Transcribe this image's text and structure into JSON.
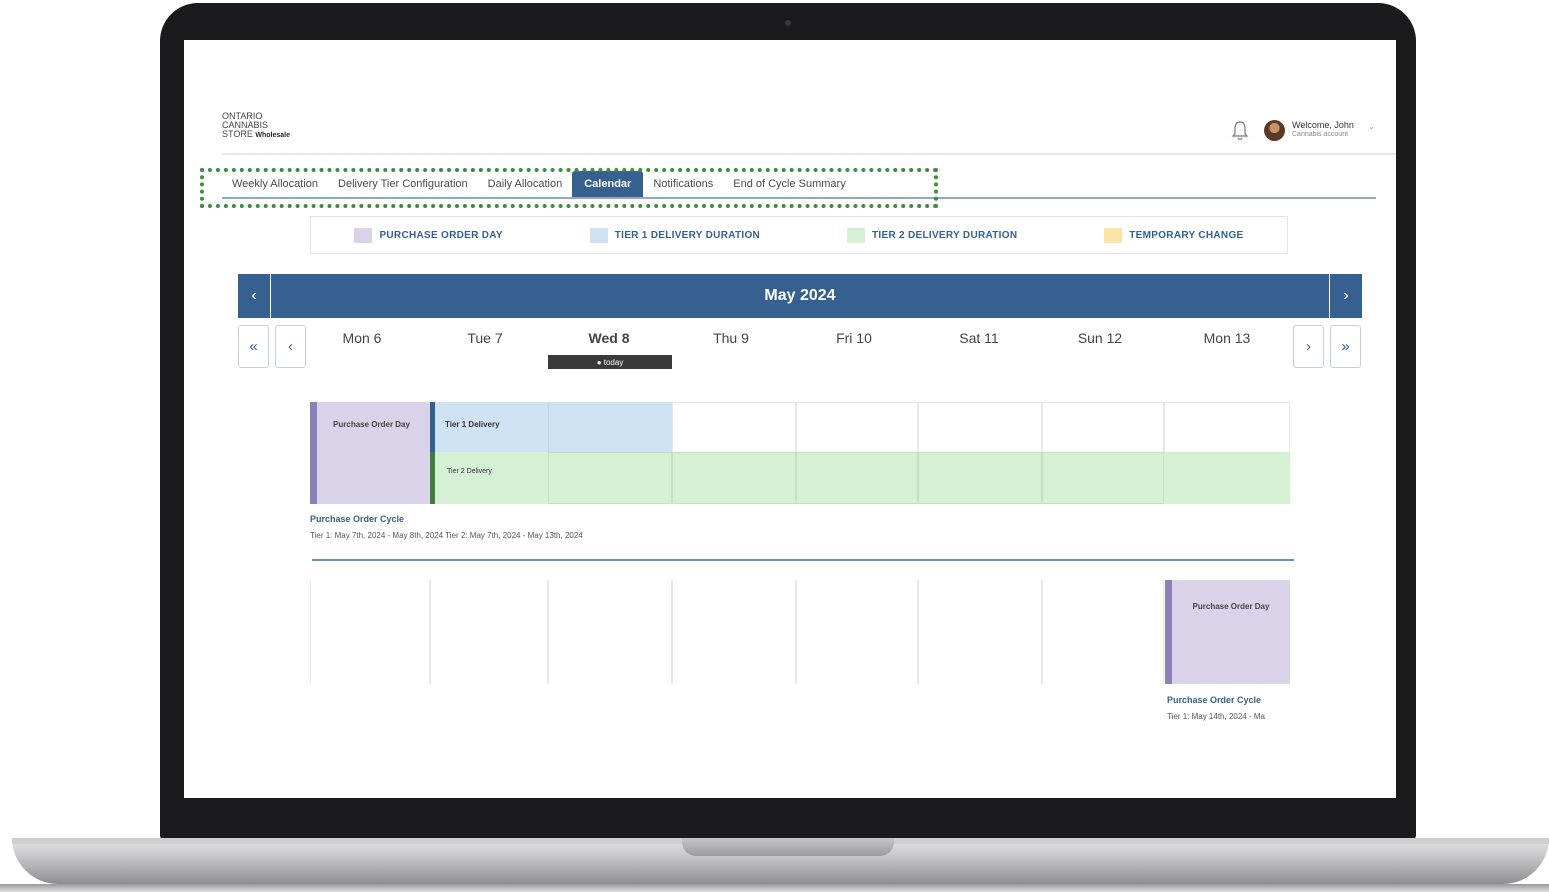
{
  "app": {
    "logo": {
      "line1": "ONTARIO",
      "line2": "CANNABIS",
      "line3": "STORE",
      "sub": "Wholesale"
    },
    "user": {
      "welcome": "Welcome, John",
      "role": "Cannabis account"
    }
  },
  "tabs": [
    {
      "label": "Weekly Allocation",
      "active": false
    },
    {
      "label": "Delivery Tier Configuration",
      "active": false
    },
    {
      "label": "Daily Allocation",
      "active": false
    },
    {
      "label": "Calendar",
      "active": true
    },
    {
      "label": "Notifications",
      "active": false
    },
    {
      "label": "End of Cycle Summary",
      "active": false
    }
  ],
  "legend": [
    {
      "label": "PURCHASE ORDER DAY",
      "color": "#d9d2e9"
    },
    {
      "label": "TIER 1 DELIVERY DURATION",
      "color": "#cfe2f3"
    },
    {
      "label": "TIER 2 DELIVERY DURATION",
      "color": "#d6f0d3"
    },
    {
      "label": "TEMPORARY CHANGE",
      "color": "#fbe5a6"
    }
  ],
  "calendar": {
    "month": "May 2024",
    "prev_month": "‹",
    "next_month": "›",
    "nav": {
      "first": "«",
      "prev": "‹",
      "next": "›",
      "last": "»"
    },
    "days": [
      "Mon 6",
      "Tue 7",
      "Wed 8",
      "Thu 9",
      "Fri 10",
      "Sat 11",
      "Sun 12",
      "Mon 13"
    ],
    "today_label": "● today",
    "today_index": 2
  },
  "cycle1": {
    "po_label": "Purchase Order Day",
    "tier1_label": "Tier 1 Delivery",
    "tier2_label": "Tier 2 Delivery",
    "title": "Purchase Order Cycle",
    "range": "Tier 1: May 7th, 2024 - May 8th, 2024   Tier 2: May 7th, 2024 - May 13th, 2024"
  },
  "cycle2": {
    "po_label": "Purchase Order Day",
    "title": "Purchase Order Cycle",
    "range": "Tier 1: May 14th, 2024 - Ma"
  },
  "colors": {
    "brand": "#35608f",
    "po": "#d9d2e9",
    "tier1": "#cfe2f3",
    "tier2": "#d6f0d3",
    "temp": "#fbe5a6",
    "highlight": "#3f8a3f"
  }
}
